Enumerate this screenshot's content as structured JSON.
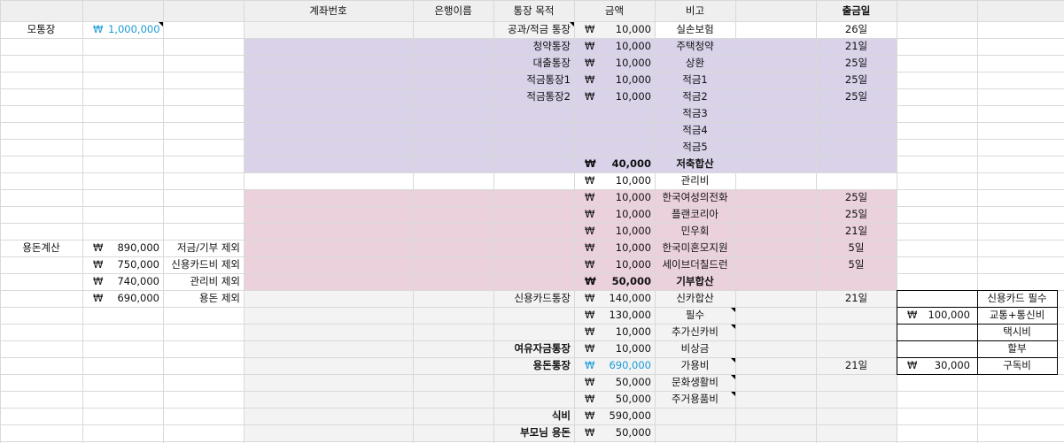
{
  "colors": {
    "header_bg": "#efefef",
    "grid_line": "#d9d9d9",
    "savings_bg": "#d9d2e9",
    "donation_bg": "#ead1dc",
    "light_gray_bg": "#f3f3f3",
    "accent_blue": "#1a9bd7"
  },
  "currency": "₩",
  "headers": {
    "account_number": "계좌번호",
    "bank_name": "은행이름",
    "account_purpose": "통장 목적",
    "amount": "금액",
    "note": "비고",
    "withdraw_day": "출금일"
  },
  "left": {
    "mother_account_label": "모통장",
    "mother_account_amount": "1,000,000",
    "allowance_calc_label": "용돈계산",
    "calc": [
      {
        "amount": "890,000",
        "desc": "저금/기부 제외"
      },
      {
        "amount": "750,000",
        "desc": "신용카드비 제외"
      },
      {
        "amount": "740,000",
        "desc": "관리비 제외"
      },
      {
        "amount": "690,000",
        "desc": "용돈 제외"
      }
    ]
  },
  "rows": [
    {
      "purpose": "공과/적금 통장",
      "amount": "10,000",
      "note": "실손보험",
      "day": "26일"
    },
    {
      "purpose": "청약통장",
      "amount": "10,000",
      "note": "주택청약",
      "day": "21일"
    },
    {
      "purpose": "대출통장",
      "amount": "10,000",
      "note": "상환",
      "day": "25일"
    },
    {
      "purpose": "적금통장1",
      "amount": "10,000",
      "note": "적금1",
      "day": "25일"
    },
    {
      "purpose": "적금통장2",
      "amount": "10,000",
      "note": "적금2",
      "day": "25일"
    },
    {
      "purpose": "",
      "amount": "",
      "note": "적금3",
      "day": ""
    },
    {
      "purpose": "",
      "amount": "",
      "note": "적금4",
      "day": ""
    },
    {
      "purpose": "",
      "amount": "",
      "note": "적금5",
      "day": ""
    },
    {
      "purpose": "",
      "amount": "40,000",
      "note": "저축합산",
      "day": ""
    },
    {
      "purpose": "",
      "amount": "10,000",
      "note": "관리비",
      "day": ""
    },
    {
      "purpose": "",
      "amount": "10,000",
      "note": "한국여성의전화",
      "day": "25일"
    },
    {
      "purpose": "",
      "amount": "10,000",
      "note": "플랜코리아",
      "day": "25일"
    },
    {
      "purpose": "",
      "amount": "10,000",
      "note": "민우회",
      "day": "21일"
    },
    {
      "purpose": "",
      "amount": "10,000",
      "note": "한국미혼모지원",
      "day": "5일"
    },
    {
      "purpose": "",
      "amount": "10,000",
      "note": "세이브더칠드런",
      "day": "5일"
    },
    {
      "purpose": "",
      "amount": "50,000",
      "note": "기부합산",
      "day": ""
    },
    {
      "purpose": "신용카드통장",
      "amount": "140,000",
      "note": "신카합산",
      "day": "21일"
    },
    {
      "purpose": "",
      "amount": "130,000",
      "note": "필수",
      "day": ""
    },
    {
      "purpose": "",
      "amount": "10,000",
      "note": "추가신카비",
      "day": ""
    },
    {
      "purpose": "여유자금통장",
      "amount": "10,000",
      "note": "비상금",
      "day": ""
    },
    {
      "purpose": "용돈통장",
      "amount": "690,000",
      "note": "가용비",
      "day": "21일"
    },
    {
      "purpose": "",
      "amount": "50,000",
      "note": "문화생활비",
      "day": ""
    },
    {
      "purpose": "",
      "amount": "50,000",
      "note": "주거용품비",
      "day": ""
    },
    {
      "purpose": "식비",
      "amount": "590,000",
      "note": "",
      "day": ""
    },
    {
      "purpose": "부모님 용돈",
      "amount": "50,000",
      "note": "",
      "day": ""
    }
  ],
  "card_box": {
    "title": "신용카드 필수",
    "items": [
      {
        "amount": "100,000",
        "label": "교통+통신비"
      },
      {
        "amount": "",
        "label": "택시비"
      },
      {
        "amount": "",
        "label": "할부"
      },
      {
        "amount": "30,000",
        "label": "구독비"
      }
    ]
  }
}
